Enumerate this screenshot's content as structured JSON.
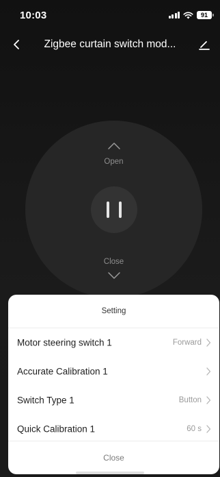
{
  "status_bar": {
    "time": "10:03",
    "battery": "91",
    "icons": [
      "signal-icon",
      "wifi-icon",
      "battery-icon"
    ]
  },
  "nav": {
    "title": "Zigbee curtain switch mod...",
    "back_icon": "chevron-left-icon",
    "edit_icon": "edit-icon"
  },
  "remote": {
    "open_label": "Open",
    "close_label": "Close",
    "pause_icon": "pause-icon"
  },
  "settings_sheet": {
    "title": "Setting",
    "rows": [
      {
        "label": "Motor steering switch 1",
        "value": "Forward"
      },
      {
        "label": "Accurate Calibration 1",
        "value": ""
      },
      {
        "label": "Switch Type 1",
        "value": "Button"
      },
      {
        "label": "Quick Calibration 1",
        "value": "60 s"
      }
    ],
    "close_label": "Close"
  },
  "colors": {
    "background": "#1b1b1b",
    "remote_circle": "#262626",
    "pause_button": "#333333",
    "sheet": "#ffffff",
    "muted_text": "#9a9a9a"
  }
}
